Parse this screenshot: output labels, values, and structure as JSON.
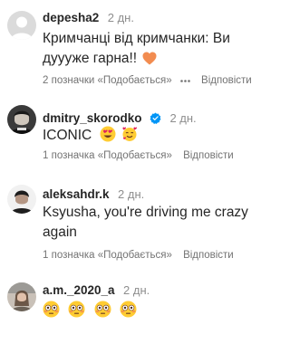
{
  "comments": [
    {
      "username": "depesha2",
      "time": "2 дн.",
      "text": "Кримчанці від кримчанки: Ви дуууже гарна!!",
      "likes": "2 позначки «Подобається»",
      "reply": "Відповісти",
      "emoji_icons": [
        "orange-heart-icon"
      ]
    },
    {
      "username": "dmitry_skorodko",
      "time": "2 дн.",
      "text": "ICONIC",
      "likes": "1 позначка «Подобається»",
      "reply": "Відповісти",
      "emoji_icons": [
        "smiling-face-with-heart-eyes-icon",
        "smiling-face-with-hearts-icon"
      ]
    },
    {
      "username": "aleksahdr.k",
      "time": "2 дн.",
      "text": "Ksyusha, you're driving me crazy again",
      "likes": "1 позначка «Подобається»",
      "reply": "Відповісти",
      "emoji_icons": []
    },
    {
      "username": "a.m._2020_a",
      "time": "2 дн.",
      "text": "",
      "likes": "",
      "reply": "",
      "emoji_icons": [
        "flushed-face-icon",
        "flushed-face-icon",
        "flushed-face-icon",
        "flushed-face-icon"
      ]
    }
  ],
  "colors": {
    "text": "#262626",
    "muted": "#737373",
    "verified": "#0095f6",
    "orange_heart": "#f28c50"
  }
}
